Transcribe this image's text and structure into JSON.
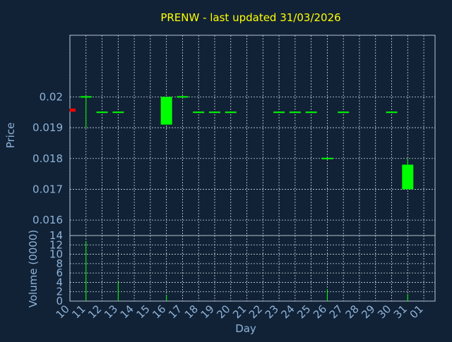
{
  "chart_data": {
    "type": "candlestick",
    "title": "PRENW - last updated 31/03/2026",
    "xlabel": "Day",
    "price_panel": {
      "ylabel": "Price",
      "ylim": [
        0.0155,
        0.022
      ],
      "yticks": [
        0.016,
        0.017,
        0.018,
        0.019,
        0.02
      ],
      "ytick_labels": [
        "0.016",
        "0.017",
        "0.018",
        "0.019",
        "0.02"
      ],
      "grid": true
    },
    "volume_panel": {
      "ylabel": "Volume (0000)",
      "ylim": [
        0,
        14
      ],
      "yticks": [
        0,
        2,
        4,
        6,
        8,
        10,
        12,
        14
      ],
      "ytick_labels": [
        "0",
        "2",
        "4",
        "6",
        "8",
        "10",
        "12",
        "14"
      ],
      "grid": true
    },
    "x_ticks": [
      "10",
      "11",
      "12",
      "13",
      "14",
      "15",
      "16",
      "17",
      "18",
      "19",
      "20",
      "21",
      "22",
      "23",
      "24",
      "25",
      "26",
      "27",
      "28",
      "29",
      "30",
      "31",
      "01"
    ],
    "x_tick_index": [
      10,
      11,
      12,
      13,
      14,
      15,
      16,
      17,
      18,
      19,
      20,
      21,
      22,
      23,
      24,
      25,
      26,
      27,
      28,
      29,
      30,
      31,
      32
    ],
    "x_range": [
      10,
      32.7
    ],
    "up_color": "#00ff00",
    "down_color": "#ff0000",
    "candles": [
      {
        "day": 10,
        "open": 0.01962,
        "high": 0.01962,
        "low": 0.01952,
        "close": 0.01952,
        "volume": 0
      },
      {
        "day": 11,
        "open": 0.02,
        "high": 0.02,
        "low": 0.019,
        "close": 0.02,
        "volume": 12.8
      },
      {
        "day": 12,
        "open": 0.0195,
        "high": 0.0195,
        "low": 0.0195,
        "close": 0.0195,
        "volume": 0
      },
      {
        "day": 13,
        "open": 0.0195,
        "high": 0.0195,
        "low": 0.0195,
        "close": 0.0195,
        "volume": 4.1
      },
      {
        "day": 16,
        "open": 0.0191,
        "high": 0.02,
        "low": 0.0191,
        "close": 0.02,
        "volume": 1.3
      },
      {
        "day": 17,
        "open": 0.02,
        "high": 0.02,
        "low": 0.02,
        "close": 0.02,
        "volume": 0
      },
      {
        "day": 18,
        "open": 0.0195,
        "high": 0.0195,
        "low": 0.0195,
        "close": 0.0195,
        "volume": 0
      },
      {
        "day": 19,
        "open": 0.0195,
        "high": 0.0195,
        "low": 0.0195,
        "close": 0.0195,
        "volume": 0
      },
      {
        "day": 20,
        "open": 0.0195,
        "high": 0.0195,
        "low": 0.0195,
        "close": 0.0195,
        "volume": 0
      },
      {
        "day": 23,
        "open": 0.0195,
        "high": 0.0195,
        "low": 0.0195,
        "close": 0.0195,
        "volume": 0
      },
      {
        "day": 24,
        "open": 0.0195,
        "high": 0.0195,
        "low": 0.0195,
        "close": 0.0195,
        "volume": 0
      },
      {
        "day": 25,
        "open": 0.0195,
        "high": 0.0195,
        "low": 0.0195,
        "close": 0.0195,
        "volume": 0
      },
      {
        "day": 26,
        "open": 0.018,
        "high": 0.018,
        "low": 0.018,
        "close": 0.018,
        "volume": 2.5
      },
      {
        "day": 27,
        "open": 0.0195,
        "high": 0.0195,
        "low": 0.0195,
        "close": 0.0195,
        "volume": 0
      },
      {
        "day": 30,
        "open": 0.0195,
        "high": 0.0195,
        "low": 0.0195,
        "close": 0.0195,
        "volume": 0
      },
      {
        "day": 31,
        "open": 0.017,
        "high": 0.018,
        "low": 0.017,
        "close": 0.0178,
        "volume": 1.5
      }
    ],
    "colors": {
      "background": "#112236",
      "title": "#ffff00",
      "axis_text": "#8fb3d9",
      "frame": "#b8c4d0",
      "grid": "#d0d8e0"
    }
  }
}
